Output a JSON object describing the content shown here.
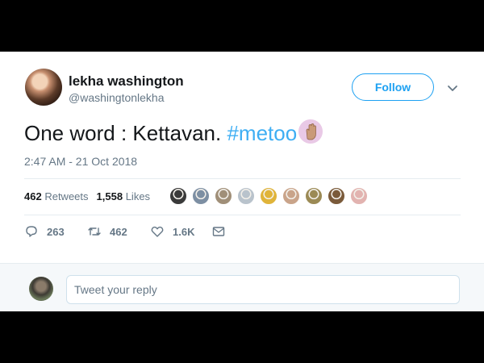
{
  "tweet": {
    "author": {
      "display_name": "lekha washington",
      "handle": "@washingtonlekha",
      "avatar_icon": "user-avatar"
    },
    "follow_label": "Follow",
    "text_plain": "One word : Kettavan. ",
    "hashtag": "#metoo",
    "emoji": "raised-hand-emoji",
    "timestamp": "2:47 AM - 21 Oct 2018",
    "stats": {
      "retweets_count": "462",
      "retweets_label": "Retweets",
      "likes_count": "1,558",
      "likes_label": "Likes"
    },
    "likers": [
      {
        "color": "#3a3a3a"
      },
      {
        "color": "#7d8fa3"
      },
      {
        "color": "#a08f78"
      },
      {
        "color": "#b9c3cc"
      },
      {
        "color": "#e0b43a"
      },
      {
        "color": "#c9a48a"
      },
      {
        "color": "#9b8a55"
      },
      {
        "color": "#7a5a3a"
      },
      {
        "color": "#e2b3b0"
      }
    ],
    "actions": {
      "reply_count": "263",
      "retweet_count": "462",
      "like_count": "1.6K"
    }
  },
  "reply": {
    "placeholder": "Tweet your reply"
  },
  "colors": {
    "accent": "#1da1f2",
    "secondary_text": "#657786",
    "primary_text": "#14171a",
    "divider": "#e6ecf0"
  }
}
